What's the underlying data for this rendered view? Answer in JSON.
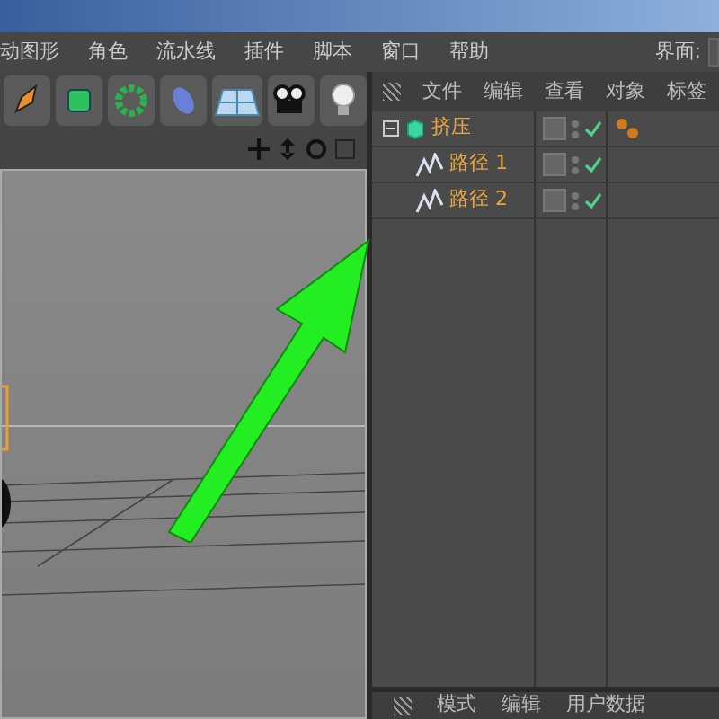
{
  "menu_bar": {
    "items": [
      "动图形",
      "角色",
      "流水线",
      "插件",
      "脚本",
      "窗口",
      "帮助"
    ],
    "layout_label": "界面:"
  },
  "object_manager": {
    "menu": [
      "文件",
      "编辑",
      "查看",
      "对象",
      "标签"
    ],
    "objects": [
      {
        "name": "挤压",
        "kind": "extrude",
        "expanded": true,
        "enabled": true,
        "has_tag": true,
        "children": [
          {
            "name": "路径 1",
            "kind": "spline",
            "enabled": true,
            "has_tag": false
          },
          {
            "name": "路径 2",
            "kind": "spline",
            "enabled": true,
            "has_tag": false
          }
        ]
      }
    ]
  },
  "attribute_manager": {
    "menu": [
      "模式",
      "编辑",
      "用户数据"
    ]
  }
}
